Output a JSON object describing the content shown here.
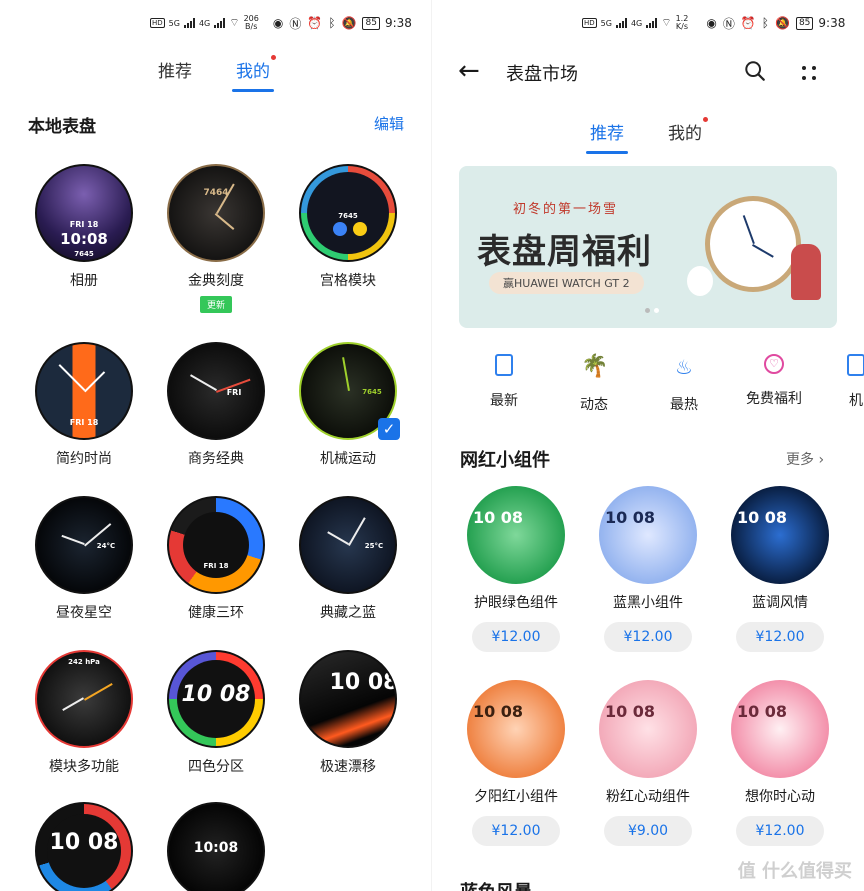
{
  "left": {
    "status": {
      "speed_value": "206",
      "speed_unit": "B/s",
      "battery": "85",
      "time": "9:38"
    },
    "tabs": [
      {
        "label": "推荐"
      },
      {
        "label": "我的"
      }
    ],
    "section_title": "本地表盘",
    "edit_label": "编辑",
    "faces": [
      {
        "name": "相册",
        "inside": "10:08",
        "date": "FRI 18",
        "steps": "7645"
      },
      {
        "name": "金典刻度",
        "badge": "更新",
        "inside": "7464"
      },
      {
        "name": "宫格模块",
        "inside": "7645"
      },
      {
        "name": "简约时尚",
        "inside": "FRI 18"
      },
      {
        "name": "商务经典",
        "inside": "FRI"
      },
      {
        "name": "机械运动",
        "inside": "7645"
      },
      {
        "name": "昼夜星空",
        "inside": "24°C"
      },
      {
        "name": "健康三环",
        "inside": "FRI 18"
      },
      {
        "name": "典藏之蓝",
        "inside": "25°C"
      },
      {
        "name": "模块多功能",
        "inside": "242 hPa"
      },
      {
        "name": "四色分区",
        "inside": "10 08"
      },
      {
        "name": "极速漂移",
        "inside": "10 08"
      },
      {
        "name": "",
        "inside": "10 08"
      },
      {
        "name": "",
        "inside": "10:08"
      }
    ]
  },
  "right": {
    "status": {
      "speed_value": "1.2",
      "speed_unit": "K/s",
      "battery": "85",
      "time": "9:38"
    },
    "title": "表盘市场",
    "tabs": [
      {
        "label": "推荐"
      },
      {
        "label": "我的"
      }
    ],
    "banner": {
      "subtitle": "初冬的第一场雪",
      "headline": "表盘周福利",
      "pill": "赢HUAWEI WATCH GT 2"
    },
    "categories": [
      {
        "label": "最新",
        "color": "#2f80ed"
      },
      {
        "label": "动态",
        "color": "#2f80ed"
      },
      {
        "label": "最热",
        "color": "#2f80ed"
      },
      {
        "label": "免费福利",
        "color": "#e04aa0"
      },
      {
        "label": "机",
        "color": "#2f80ed"
      }
    ],
    "section_title": "网红小组件",
    "more_label": "更多",
    "products": [
      {
        "name": "护眼绿色组件",
        "price": "¥12.00",
        "inside": "10 08"
      },
      {
        "name": "蓝黑小组件",
        "price": "¥12.00",
        "inside": "10 08"
      },
      {
        "name": "蓝调风情",
        "price": "¥12.00",
        "inside": "10 08"
      },
      {
        "name": "夕阳红小组件",
        "price": "¥12.00",
        "inside": "10 08"
      },
      {
        "name": "粉红心动组件",
        "price": "¥9.00",
        "inside": "10 08"
      },
      {
        "name": "想你时心动",
        "price": "¥12.00",
        "inside": "10 08"
      }
    ],
    "next_section": "蓝色风暴",
    "watermark": "值 什么值得买"
  }
}
